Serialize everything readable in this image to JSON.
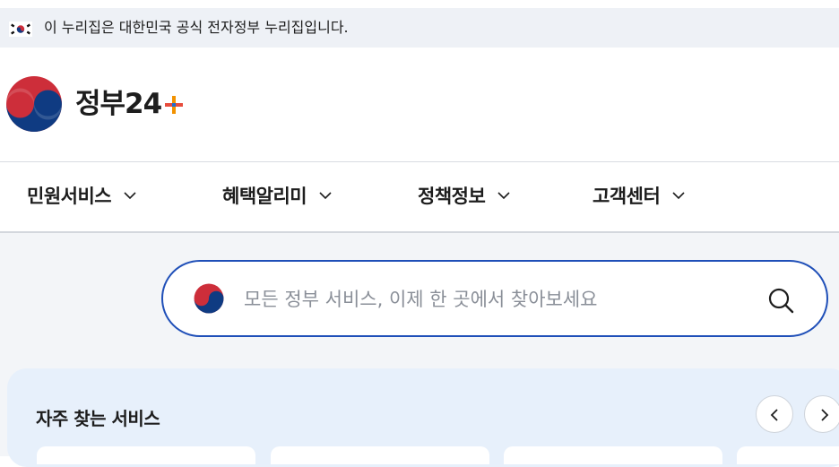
{
  "notice": {
    "text": "이 누리집은 대한민국 공식 전자정부 누리집입니다."
  },
  "brand": {
    "name": "정부24"
  },
  "nav": {
    "items": [
      {
        "label": "민원서비스"
      },
      {
        "label": "혜택알리미"
      },
      {
        "label": "정책정보"
      },
      {
        "label": "고객센터"
      }
    ]
  },
  "search": {
    "placeholder": "모든 정부 서비스, 이제 한 곳에서 찾아보세요",
    "value": ""
  },
  "frequent": {
    "title": "자주 찾는 서비스"
  },
  "colors": {
    "accent": "#1f4fb8",
    "taegeuk_red": "#cd2e3a",
    "taegeuk_blue": "#0f3b82",
    "panel_bg": "#e7f0fb"
  },
  "icons": {
    "flag": "korean-flag-icon",
    "logo": "taegeuk-logo-icon",
    "chevron": "chevron-down-icon",
    "search": "search-icon",
    "prev": "chevron-left-icon",
    "next": "chevron-right-icon"
  }
}
